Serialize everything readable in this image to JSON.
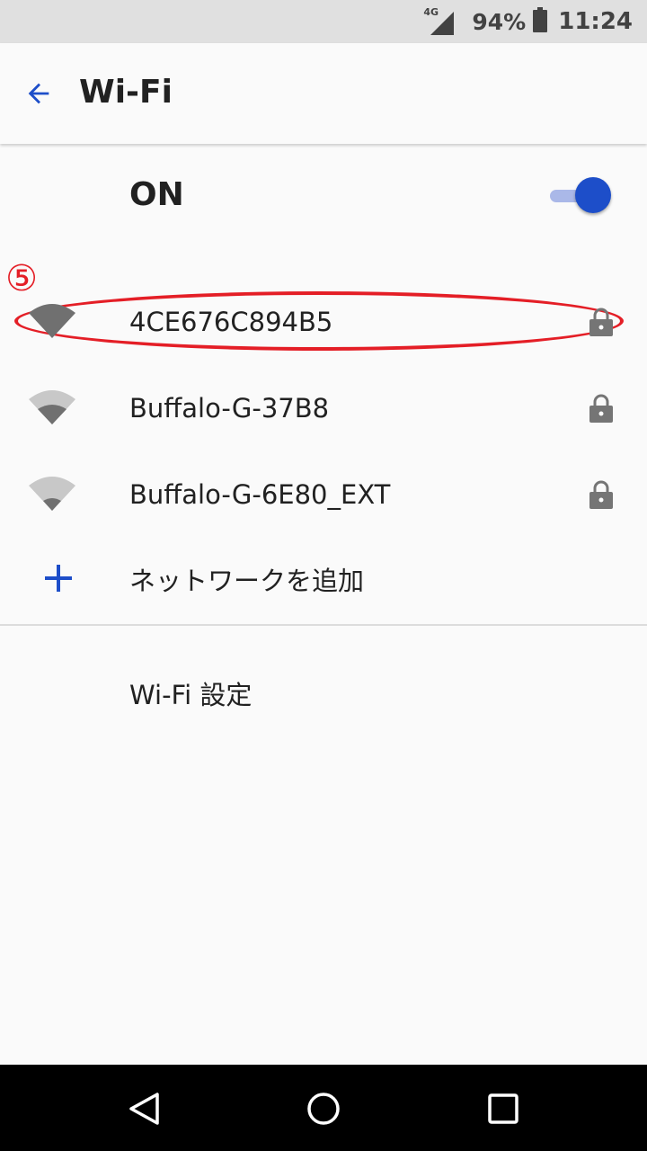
{
  "status_bar": {
    "network_type": "4G",
    "battery_percent": "94%",
    "time": "11:24"
  },
  "app_bar": {
    "title": "Wi-Fi",
    "back_icon": "arrow-back-icon"
  },
  "wifi_toggle": {
    "label": "ON",
    "state": "on"
  },
  "annotation": {
    "marker": "⑤",
    "color": "#e41e26"
  },
  "networks": [
    {
      "ssid": "4CE676C894B5",
      "signal": "full",
      "secured": true
    },
    {
      "ssid": "Buffalo-G-37B8",
      "signal": "medium",
      "secured": true
    },
    {
      "ssid": "Buffalo-G-6E80_EXT",
      "signal": "low",
      "secured": true
    }
  ],
  "add_network": {
    "label": "ネットワークを追加",
    "icon": "plus-icon"
  },
  "settings_link": {
    "label": "Wi-Fi 設定"
  },
  "nav_bar": {
    "back_icon": "nav-back-icon",
    "home_icon": "nav-home-icon",
    "recents_icon": "nav-recents-icon"
  },
  "colors": {
    "accent": "#1d4ec9",
    "background": "#fafafa",
    "status_bar": "#e0e0e0",
    "nav_bar": "#000000"
  }
}
